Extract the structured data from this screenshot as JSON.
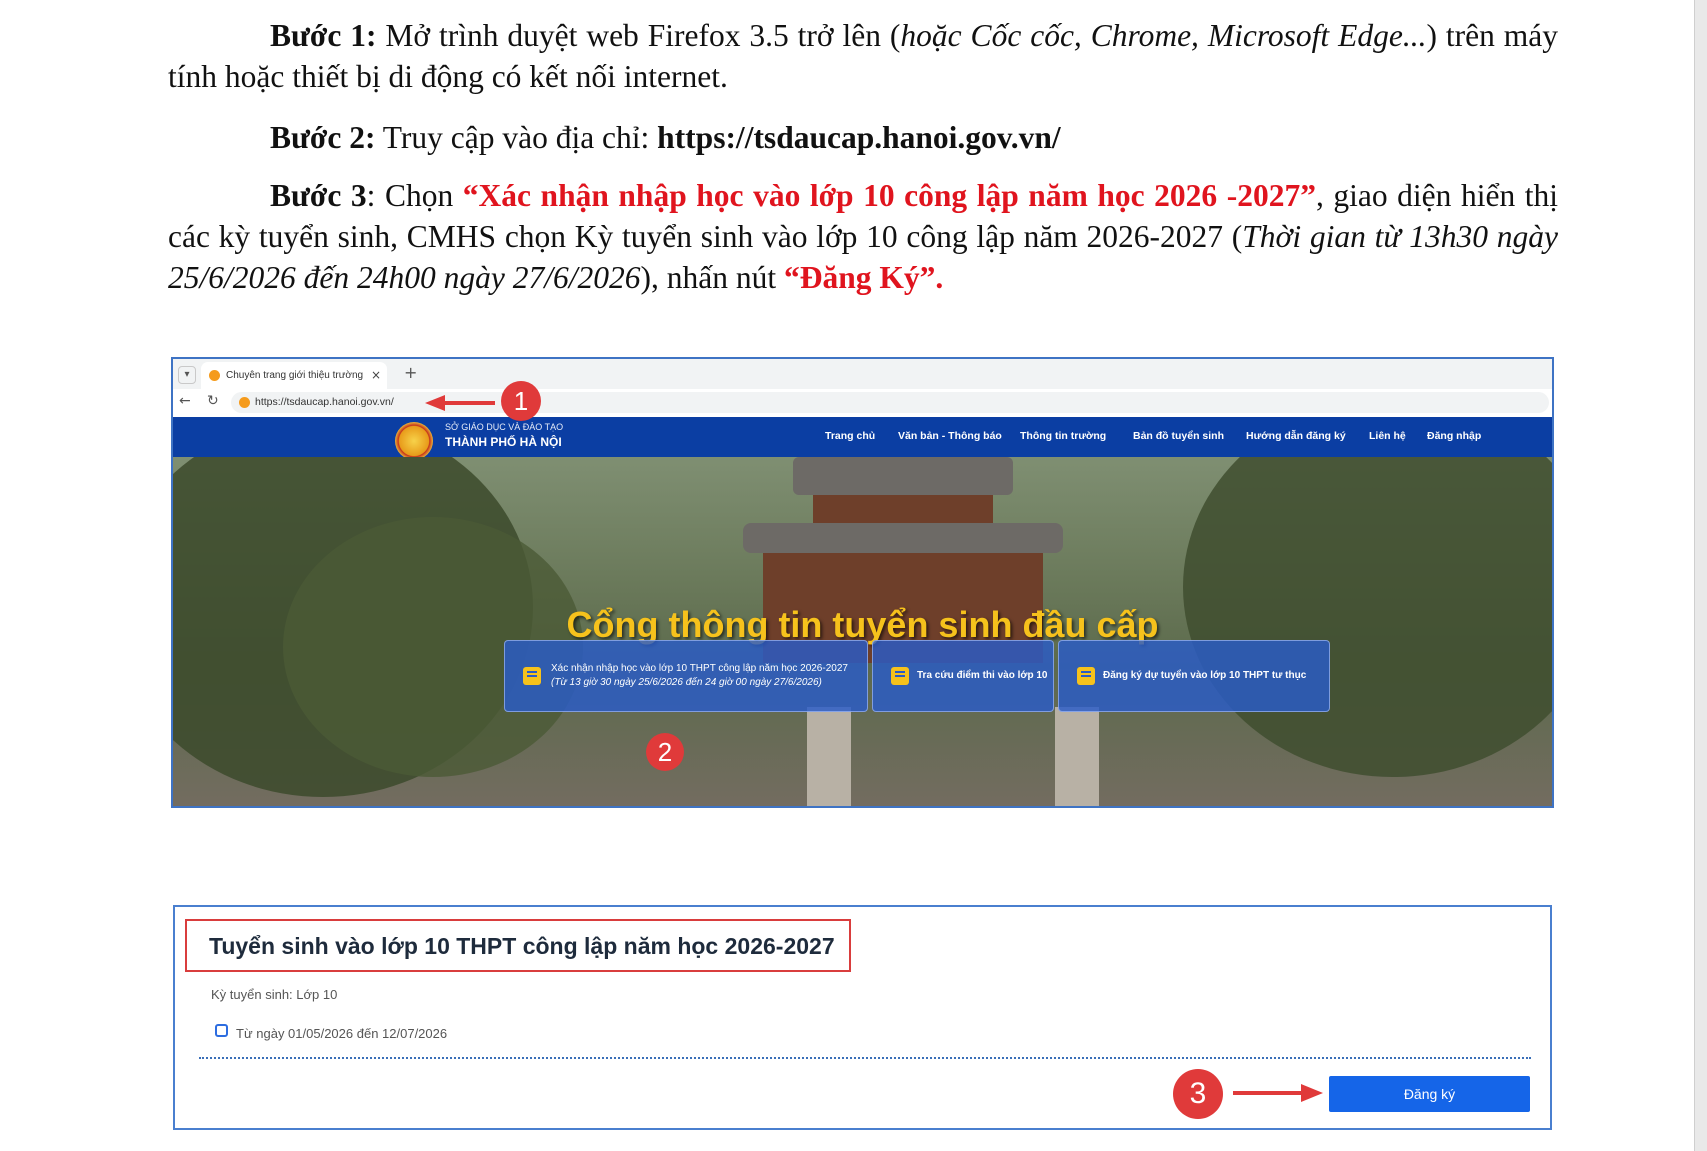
{
  "steps": {
    "step1": {
      "label": "Bước 1:",
      "text_a": " Mở trình duyệt web Firefox 3.5 trở lên (",
      "italic": "hoặc Cốc cốc, Chrome, Microsoft Edge...",
      "text_b": ") trên máy tính hoặc thiết bị di động có kết nối internet."
    },
    "step2": {
      "label": "Bước 2:",
      "text": " Truy cập vào địa chỉ: ",
      "url": "https://tsdaucap.hanoi.gov.vn/"
    },
    "step3": {
      "label": "Bước 3",
      "text_a": ": Chọn ",
      "highlight": "“Xác nhận nhập học vào lớp 10 công lập năm học 2026 -2027”",
      "text_b": ", giao diện hiển thị các kỳ tuyển sinh, CMHS chọn Kỳ tuyển sinh vào lớp 10 công lập năm 2026-2027 (",
      "italic": "Thời gian từ 13h30 ngày 25/6/2026 đến 24h00 ngày 27/6/2026",
      "text_c": "), nhấn nút ",
      "button_ref": "“Đăng Ký”."
    }
  },
  "browser": {
    "tab_title": "Chuyên trang giới thiệu trường tư",
    "tab_close": "×",
    "new_tab": "+",
    "url": "https://tsdaucap.hanoi.gov.vn/"
  },
  "site": {
    "org_top": "SỞ GIÁO DỤC VÀ ĐÀO TẠO",
    "org_main": "THÀNH PHỐ HÀ NỘI",
    "menu": [
      "Trang chủ",
      "Văn bản - Thông báo",
      "Thông tin trường",
      "Bản đồ tuyển sinh",
      "Hướng dẫn đăng ký",
      "Liên hệ",
      "Đăng nhập"
    ],
    "hero_title": "Cổng thông tin tuyển sinh đầu cấp",
    "cards": [
      {
        "line1": "Xác nhận nhập học vào lớp 10 THPT công lập năm học 2026-2027",
        "line2": "(Từ 13 giờ 30 ngày 25/6/2026 đến 24 giờ 00 ngày 27/6/2026)"
      },
      {
        "line1": "Tra cứu điểm thi vào lớp 10"
      },
      {
        "line1": "Đăng ký dự tuyển vào lớp 10 THPT tư thục"
      }
    ]
  },
  "markers": [
    "1",
    "2",
    "3"
  ],
  "enrollment": {
    "title": "Tuyển sinh vào lớp 10 THPT công lập năm học 2026-2027",
    "period_label": "Kỳ tuyển sinh: Lớp 10",
    "date_range": "Từ ngày 01/05/2026 đến 12/07/2026",
    "register_button": "Đăng ký"
  },
  "colors": {
    "accent_red": "#e0141e",
    "nav_blue": "#0b3ea3",
    "button_blue": "#1565e8",
    "marker_red": "#e03a3a"
  },
  "icons": [
    "chevron-down-icon",
    "favicon-icon",
    "close-icon",
    "plus-icon",
    "back-arrow-icon",
    "reload-icon",
    "edit-note-icon",
    "calendar-icon",
    "arrow-right-icon"
  ]
}
